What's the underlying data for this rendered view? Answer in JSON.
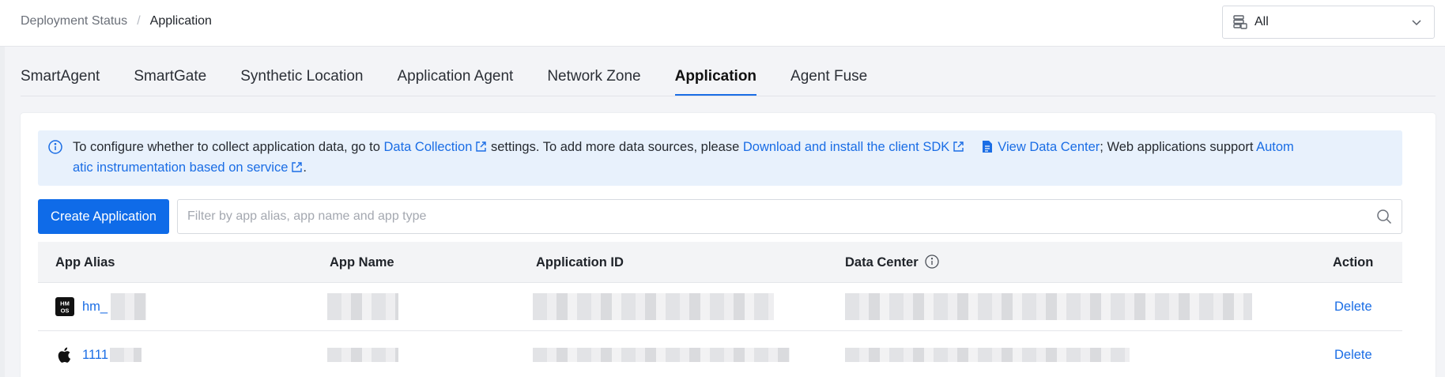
{
  "breadcrumb": {
    "parent": "Deployment Status",
    "separator": "/",
    "current": "Application"
  },
  "data_center_select": {
    "value": "All",
    "icon": "database-icon"
  },
  "tabs": [
    {
      "label": "SmartAgent",
      "active": false
    },
    {
      "label": "SmartGate",
      "active": false
    },
    {
      "label": "Synthetic Location",
      "active": false
    },
    {
      "label": "Application Agent",
      "active": false
    },
    {
      "label": "Network Zone",
      "active": false
    },
    {
      "label": "Application",
      "active": true
    },
    {
      "label": "Agent Fuse",
      "active": false
    }
  ],
  "notice": {
    "text1": "To configure whether to collect application data, go to ",
    "link1": "Data Collection",
    "text2": " settings. To add more data sources, please ",
    "link2": "Download and install the client SDK",
    "link3": "View Data Center",
    "text3": "; Web applications support ",
    "link4": "Autom",
    "link4b": "atic instrumentation based on service",
    "text4": "."
  },
  "toolbar": {
    "create_label": "Create Application",
    "search_placeholder": "Filter by app alias, app name and app type"
  },
  "table": {
    "headers": {
      "alias": "App Alias",
      "name": "App Name",
      "id": "Application ID",
      "dc": "Data Center",
      "action": "Action"
    },
    "rows": [
      {
        "icon": "harmonyos-icon",
        "alias": "hm_",
        "action": "Delete"
      },
      {
        "icon": "apple-icon",
        "alias": "1111",
        "action": "Delete"
      }
    ]
  },
  "colors": {
    "accent": "#1a6de5",
    "primary_button": "#0f6be8",
    "notice_bg": "#e8f1fc"
  }
}
